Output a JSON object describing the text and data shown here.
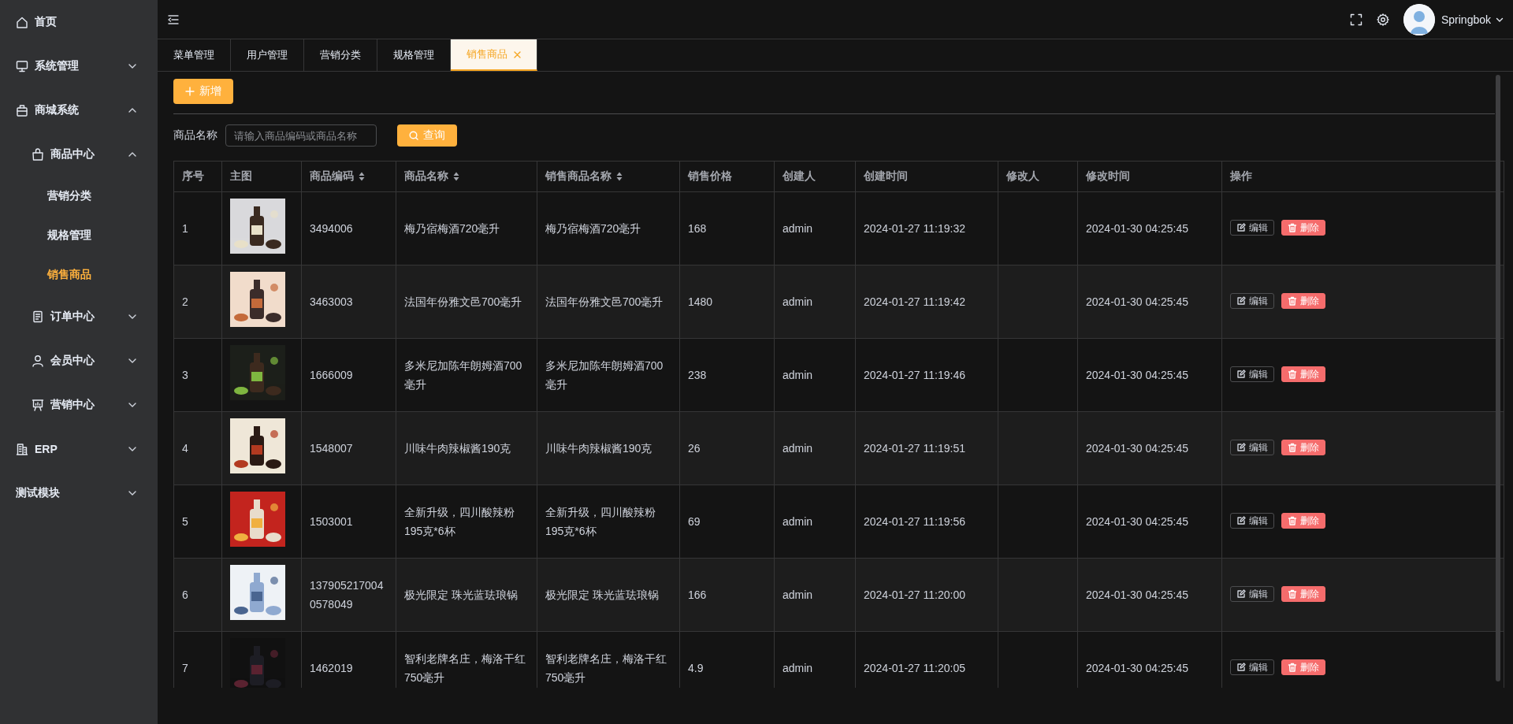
{
  "sidebar": {
    "items": [
      {
        "label": "首页",
        "selected": false
      },
      {
        "label": "系统管理",
        "selected": false,
        "expanded": false
      },
      {
        "label": "商城系统",
        "selected": false,
        "expanded": true,
        "children": [
          {
            "label": "商品中心",
            "selected": false,
            "expanded": true,
            "children": [
              {
                "label": "营销分类",
                "selected": false
              },
              {
                "label": "规格管理",
                "selected": false
              },
              {
                "label": "销售商品",
                "selected": true
              }
            ]
          },
          {
            "label": "订单中心",
            "selected": false,
            "expanded": false
          },
          {
            "label": "会员中心",
            "selected": false,
            "expanded": false
          },
          {
            "label": "营销中心",
            "selected": false,
            "expanded": false
          }
        ]
      },
      {
        "label": "ERP",
        "selected": false,
        "expanded": false
      },
      {
        "label": "测试模块",
        "selected": false,
        "expanded": false
      }
    ]
  },
  "header": {
    "user": "Springbok"
  },
  "tabs": [
    {
      "label": "菜单管理",
      "selected": false
    },
    {
      "label": "用户管理",
      "selected": false
    },
    {
      "label": "营销分类",
      "selected": false
    },
    {
      "label": "规格管理",
      "selected": false
    },
    {
      "label": "销售商品",
      "selected": true
    }
  ],
  "toolbar": {
    "add_button": "新增"
  },
  "search": {
    "label": "商品名称",
    "placeholder": "请输入商品编码或商品名称",
    "button": "查询"
  },
  "table": {
    "columns": [
      {
        "label": "序号",
        "sortable": false
      },
      {
        "label": "主图",
        "sortable": false
      },
      {
        "label": "商品编码",
        "sortable": true
      },
      {
        "label": "商品名称",
        "sortable": true
      },
      {
        "label": "销售商品名称",
        "sortable": true
      },
      {
        "label": "销售价格",
        "sortable": false
      },
      {
        "label": "创建人",
        "sortable": false
      },
      {
        "label": "创建时间",
        "sortable": false
      },
      {
        "label": "修改人",
        "sortable": false
      },
      {
        "label": "修改时间",
        "sortable": false
      },
      {
        "label": "操作",
        "sortable": false
      }
    ],
    "rows": [
      {
        "index": "1",
        "code": "3494006",
        "name": "梅乃宿梅酒720毫升",
        "sale_name": "梅乃宿梅酒720毫升",
        "price": "168",
        "creator": "admin",
        "created": "2024-01-27 11:19:32",
        "modified": "2024-01-30 04:25:45",
        "actions": [
          {
            "kind": "edit",
            "label": "编辑"
          },
          {
            "kind": "delete",
            "label": "删除"
          }
        ]
      },
      {
        "index": "2",
        "code": "3463003",
        "name": "法国年份雅文邑700毫升",
        "sale_name": "法国年份雅文邑700毫升",
        "price": "1480",
        "creator": "admin",
        "created": "2024-01-27 11:19:42",
        "modified": "2024-01-30 04:25:45",
        "actions": [
          {
            "kind": "edit",
            "label": "编辑"
          },
          {
            "kind": "delete",
            "label": "删除"
          }
        ]
      },
      {
        "index": "3",
        "code": "1666009",
        "name": "多米尼加陈年朗姆酒700毫升",
        "sale_name": "多米尼加陈年朗姆酒700毫升",
        "price": "238",
        "creator": "admin",
        "created": "2024-01-27 11:19:46",
        "modified": "2024-01-30 04:25:45",
        "actions": [
          {
            "kind": "edit",
            "label": "编辑"
          },
          {
            "kind": "delete",
            "label": "删除"
          }
        ]
      },
      {
        "index": "4",
        "code": "1548007",
        "name": "川味牛肉辣椒酱190克",
        "sale_name": "川味牛肉辣椒酱190克",
        "price": "26",
        "creator": "admin",
        "created": "2024-01-27 11:19:51",
        "modified": "2024-01-30 04:25:45",
        "actions": [
          {
            "kind": "edit",
            "label": "编辑"
          },
          {
            "kind": "delete",
            "label": "删除"
          }
        ]
      },
      {
        "index": "5",
        "code": "1503001",
        "name": "全新升级，四川酸辣粉195克*6杯",
        "sale_name": "全新升级，四川酸辣粉195克*6杯",
        "price": "69",
        "creator": "admin",
        "created": "2024-01-27 11:19:56",
        "modified": "2024-01-30 04:25:45",
        "actions": [
          {
            "kind": "edit",
            "label": "编辑"
          },
          {
            "kind": "delete",
            "label": "删除"
          }
        ]
      },
      {
        "index": "6",
        "code": "1379052170040578049",
        "name": "极光限定 珠光蓝珐琅锅",
        "sale_name": "极光限定 珠光蓝珐琅锅",
        "price": "166",
        "creator": "admin",
        "created": "2024-01-27 11:20:00",
        "modified": "2024-01-30 04:25:45",
        "actions": [
          {
            "kind": "edit",
            "label": "编辑"
          },
          {
            "kind": "delete",
            "label": "删除"
          }
        ]
      },
      {
        "index": "7",
        "code": "1462019",
        "name": "智利老牌名庄，梅洛干红750毫升",
        "sale_name": "智利老牌名庄，梅洛干红750毫升",
        "price": "4.9",
        "creator": "admin",
        "created": "2024-01-27 11:20:05",
        "modified": "2024-01-30 04:25:45",
        "actions": [
          {
            "kind": "edit",
            "label": "编辑"
          },
          {
            "kind": "delete",
            "label": "删除"
          }
        ]
      }
    ]
  }
}
